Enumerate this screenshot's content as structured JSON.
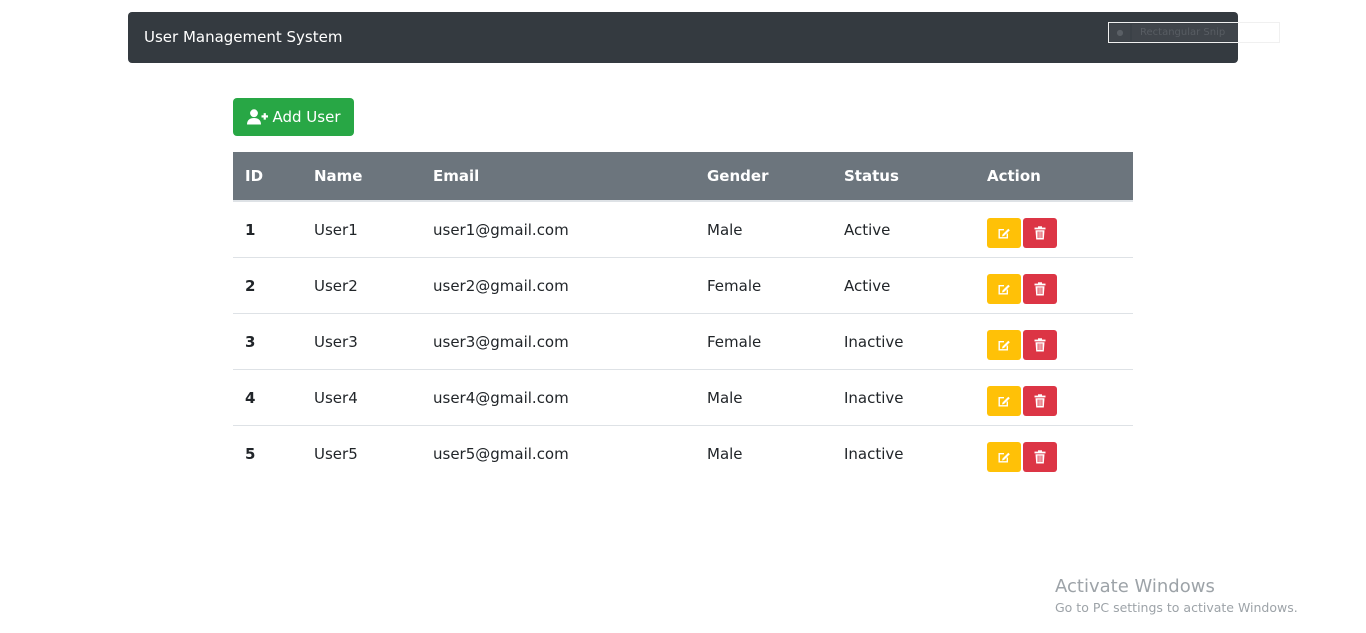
{
  "navbar": {
    "brand": "User Management System"
  },
  "snip_tool": {
    "label": "Rectangular Snip"
  },
  "toolbar": {
    "add_user_label": "Add User"
  },
  "table": {
    "headers": [
      "ID",
      "Name",
      "Email",
      "Gender",
      "Status",
      "Action"
    ],
    "rows": [
      {
        "id": "1",
        "name": "User1",
        "email": "user1@gmail.com",
        "gender": "Male",
        "status": "Active"
      },
      {
        "id": "2",
        "name": "User2",
        "email": "user2@gmail.com",
        "gender": "Female",
        "status": "Active"
      },
      {
        "id": "3",
        "name": "User3",
        "email": "user3@gmail.com",
        "gender": "Female",
        "status": "Inactive"
      },
      {
        "id": "4",
        "name": "User4",
        "email": "user4@gmail.com",
        "gender": "Male",
        "status": "Inactive"
      },
      {
        "id": "5",
        "name": "User5",
        "email": "user5@gmail.com",
        "gender": "Male",
        "status": "Inactive"
      }
    ],
    "icons": {
      "edit": "edit-icon",
      "delete": "trash-icon"
    }
  },
  "watermark": {
    "title": "Activate Windows",
    "subtitle": "Go to PC settings to activate Windows."
  },
  "colors": {
    "navbar_bg": "#343a40",
    "add_button": "#28a745",
    "table_header": "#6c757d",
    "edit_button": "#ffc107",
    "delete_button": "#dc3545"
  }
}
